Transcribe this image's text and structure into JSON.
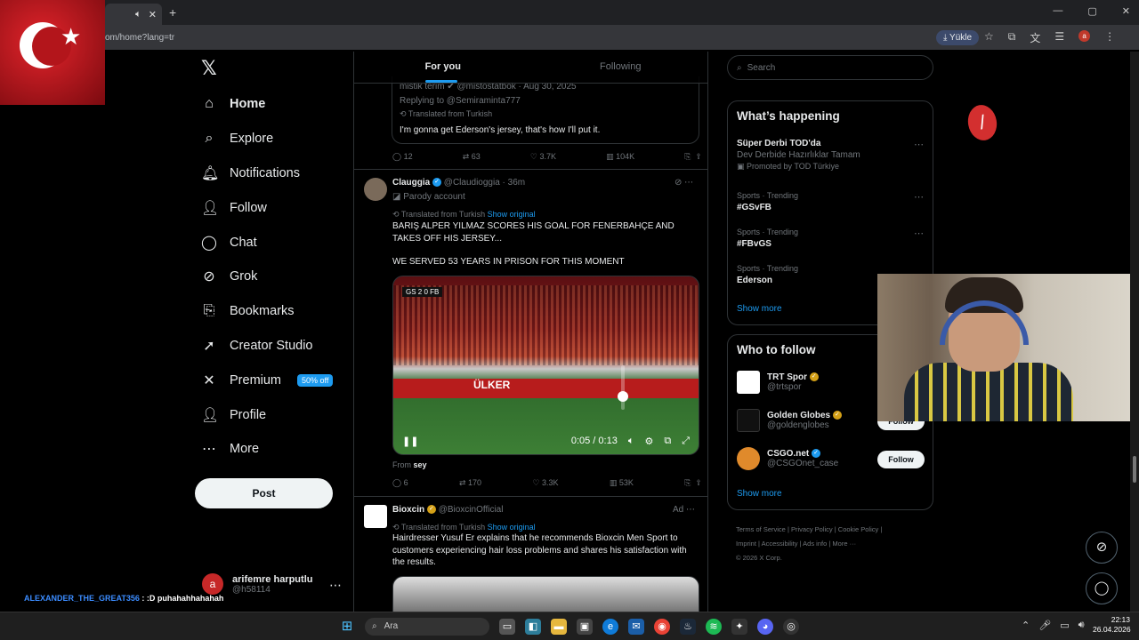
{
  "browser": {
    "tab_mute_icon": "speaker-icon",
    "tab_close": "✕",
    "new_tab": "+",
    "url": "om/home?lang=tr",
    "yukle_label": "Yükle",
    "profile_letter": "a",
    "window_controls": [
      "—",
      "▢",
      "✕"
    ]
  },
  "sidebar": {
    "logo": "𝕏",
    "items": [
      {
        "label": "Home",
        "icon": "home-icon",
        "glyph": "⌂"
      },
      {
        "label": "Explore",
        "icon": "search-icon",
        "glyph": "⌕"
      },
      {
        "label": "Notifications",
        "icon": "bell-icon",
        "glyph": "🔔︎"
      },
      {
        "label": "Follow",
        "icon": "person-plus-icon",
        "glyph": "👤︎"
      },
      {
        "label": "Chat",
        "icon": "chat-icon",
        "glyph": "◯"
      },
      {
        "label": "Grok",
        "icon": "grok-icon",
        "glyph": "⊘"
      },
      {
        "label": "Bookmarks",
        "icon": "bookmark-icon",
        "glyph": "⎘"
      },
      {
        "label": "Creator Studio",
        "icon": "rocket-icon",
        "glyph": "➚"
      },
      {
        "label": "Premium",
        "icon": "x-icon",
        "glyph": "✕",
        "badge": "50% off"
      },
      {
        "label": "Profile",
        "icon": "person-icon",
        "glyph": "👤︎"
      },
      {
        "label": "More",
        "icon": "more-circle-icon",
        "glyph": "⋯"
      }
    ],
    "post_label": "Post",
    "account": {
      "avatar_letter": "a",
      "name": "arifemre harputlu",
      "handle": "@h58114",
      "more": "⋯"
    }
  },
  "stream_chat": {
    "user": "ALEXANDER_THE_GREAT356",
    "message": ": :D puhahahhahahah"
  },
  "feed": {
    "tabs": [
      "For you",
      "Following"
    ],
    "quoted_post": {
      "header": "mistik terim ✔ @mistostatbok · Aug 30, 2025",
      "replying": "Replying to @Semiraminta777",
      "translated": "Translated from Turkish",
      "text": "I'm gonna get Ederson's jersey, that's how I'll put it.",
      "stats": {
        "replies": "12",
        "reposts": "63",
        "likes": "3.7K",
        "views": "104K"
      }
    },
    "post1": {
      "name": "Clauggia",
      "handle": "@Claudioggia · 36m",
      "parody": "Parody account",
      "translated": "Translated from Turkish",
      "show_original": "Show original",
      "text1": "BARIŞ ALPER YILMAZ SCORES HIS GOAL FOR FENERBAHÇE AND TAKES OFF HIS JERSEY...",
      "text2": "WE SERVED 53 YEARS IN PRISON FOR THIS MOMENT",
      "video": {
        "time": "0:05 / 0:13",
        "board_text": "ÜLKER",
        "score": "GS 2 0 FB",
        "volume_level": 0.25
      },
      "from_label": "From",
      "from_user": "sey",
      "stats": {
        "replies": "6",
        "reposts": "170",
        "likes": "3.3K",
        "views": "53K"
      }
    },
    "post2": {
      "name": "Bioxcin",
      "handle": "@BioxcinOfficial",
      "ad": "Ad",
      "translated": "Translated from Turkish",
      "show_original": "Show original",
      "text": "Hairdresser Yusuf Er explains that he recommends Bioxcin Men Sport to customers experiencing hair loss problems and shares his satisfaction with the results."
    }
  },
  "right": {
    "search_placeholder": "Search",
    "whats_happening": {
      "title": "What’s happening",
      "trends": [
        {
          "context": "",
          "title": "Süper Derbi TOD'da",
          "sub": "Dev Derbide Hazırlıklar Tamam",
          "promo": "Promoted by TOD Türkiye"
        },
        {
          "context": "Sports · Trending",
          "title": "#GSvFB",
          "sub": "",
          "promo": ""
        },
        {
          "context": "Sports · Trending",
          "title": "#FBvGS",
          "sub": "",
          "promo": ""
        },
        {
          "context": "Sports · Trending",
          "title": "Ederson",
          "sub": "",
          "promo": ""
        }
      ],
      "show_more": "Show more"
    },
    "who_to_follow": {
      "title": "Who to follow",
      "accounts": [
        {
          "name": "TRT Spor",
          "handle": "@trtspor"
        },
        {
          "name": "Golden Globes",
          "handle": "@goldenglobes"
        },
        {
          "name": "CSGO.net",
          "handle": "@CSGOnet_case"
        }
      ],
      "follow_label": "Follow",
      "show_more": "Show more"
    },
    "footer": [
      "Terms of Service",
      "Privacy Policy",
      "Cookie Policy",
      "Imprint",
      "Accessibility",
      "Ads info",
      "More ···",
      "© 2026 X Corp."
    ]
  },
  "taskbar": {
    "search_label": "Ara",
    "time": "22:13",
    "date": "26.04.2026"
  }
}
